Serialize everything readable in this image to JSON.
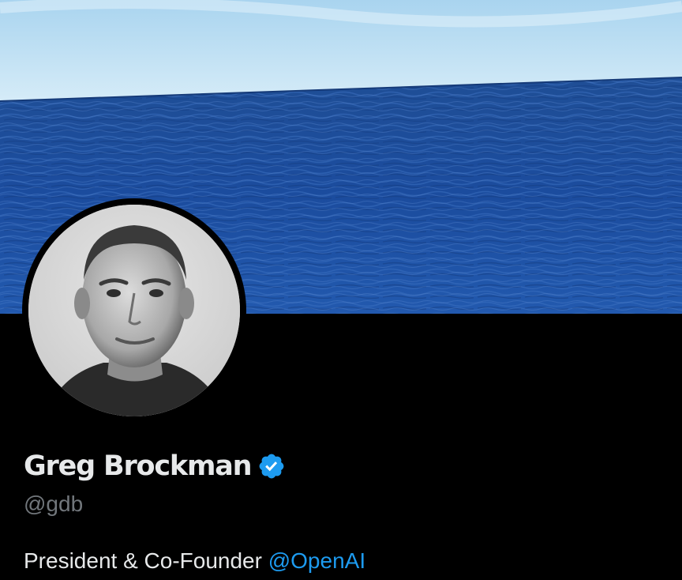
{
  "banner": {
    "sky_color": "#bfe0f3",
    "sea_color": "#1c4fa0"
  },
  "avatar": {
    "icon": "profile-photo"
  },
  "profile": {
    "display_name": "Greg Brockman",
    "verified_icon": "verified-badge-icon",
    "handle": "@gdb",
    "bio_text": "President & Co-Founder ",
    "bio_mention": "@OpenAI"
  },
  "colors": {
    "background": "#000000",
    "primary_text": "#e7e9ea",
    "secondary_text": "#71767b",
    "accent": "#1d9bf0"
  }
}
